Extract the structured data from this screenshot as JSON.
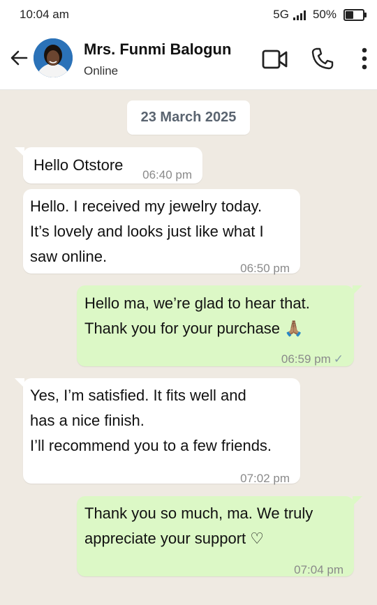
{
  "status_bar": {
    "time": "10:04 am",
    "network": "5G",
    "battery_percent": "50%",
    "battery_level": 0.5
  },
  "header": {
    "contact_name": "Mrs. Funmi Balogun",
    "contact_status": "Online",
    "icons": [
      "back-arrow-icon",
      "video-call-icon",
      "voice-call-icon",
      "more-options-icon"
    ]
  },
  "chat": {
    "date": "23 March 2025",
    "messages": [
      {
        "direction": "in",
        "text": "Hello Otstore",
        "time": "06:40 pm"
      },
      {
        "direction": "in",
        "text": " Hello. I received my jewelry today.\nIt’s lovely and looks just like what I\nsaw online.",
        "time": "06:50 pm"
      },
      {
        "direction": "out",
        "text": " Hello ma, we’re glad to hear that.\nThank you for your purchase 🙏🏽",
        "time": "06:59 pm",
        "status": "✓"
      },
      {
        "direction": "in",
        "text": " Yes, I’m satisfied. It fits well and\nhas a nice finish.\nI’ll recommend you to a few friends.",
        "time": "07:02 pm"
      },
      {
        "direction": "out",
        "text": " Thank you so much, ma. We truly\nappreciate your support ♡",
        "time": "07:04 pm"
      }
    ]
  },
  "colors": {
    "chat_background": "#efeae2",
    "incoming_bubble": "#ffffff",
    "outgoing_bubble": "#dcf8c6"
  }
}
